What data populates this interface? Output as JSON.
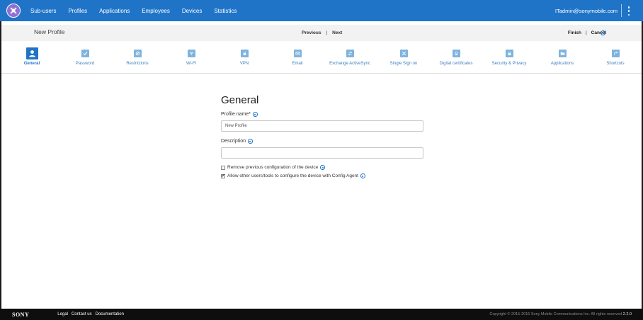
{
  "topnav": {
    "items": [
      "Sub-users",
      "Profiles",
      "Applications",
      "Employees",
      "Devices",
      "Statistics"
    ],
    "user": "ITadmin@sonymobile.com",
    "brand_color": "#1f74c8"
  },
  "subheader": {
    "title": "New Profile",
    "previous": "Previous",
    "next": "Next",
    "separator": "|",
    "finish": "Finish",
    "cancel": "Cancel"
  },
  "steps": [
    {
      "label": "General",
      "icon": "user-icon"
    },
    {
      "label": "Password",
      "icon": "password-check-icon"
    },
    {
      "label": "Restrictions",
      "icon": "restrictions-icon"
    },
    {
      "label": "Wi-Fi",
      "icon": "wifi-icon"
    },
    {
      "label": "VPN",
      "icon": "vpn-icon"
    },
    {
      "label": "Email",
      "icon": "email-icon"
    },
    {
      "label": "Exchange ActiveSync",
      "icon": "exchange-icon"
    },
    {
      "label": "Single Sign on",
      "icon": "sso-icon"
    },
    {
      "label": "Digital certificates",
      "icon": "certificate-icon"
    },
    {
      "label": "Security & Privacy",
      "icon": "lock-icon"
    },
    {
      "label": "Applications",
      "icon": "folder-icon"
    },
    {
      "label": "Shortcuts",
      "icon": "shortcut-icon"
    }
  ],
  "form": {
    "heading": "General",
    "profile_name_label": "Profile name",
    "required_mark": "*",
    "profile_name_value": "New Profile",
    "description_label": "Description",
    "description_value": "",
    "remove_config_label": "Remove previous configuration of the device",
    "remove_config_checked": false,
    "allow_others_label": "Allow other users/tools to configure the device with Config Agent",
    "allow_others_checked": true
  },
  "footer": {
    "brand": "SONY",
    "links": [
      "Legal",
      "Contact us",
      "Documentation"
    ],
    "copyright": "Copyright © 2015-2016 Sony Mobile Communications Inc. All rights reserved",
    "version": "2.2.0"
  }
}
